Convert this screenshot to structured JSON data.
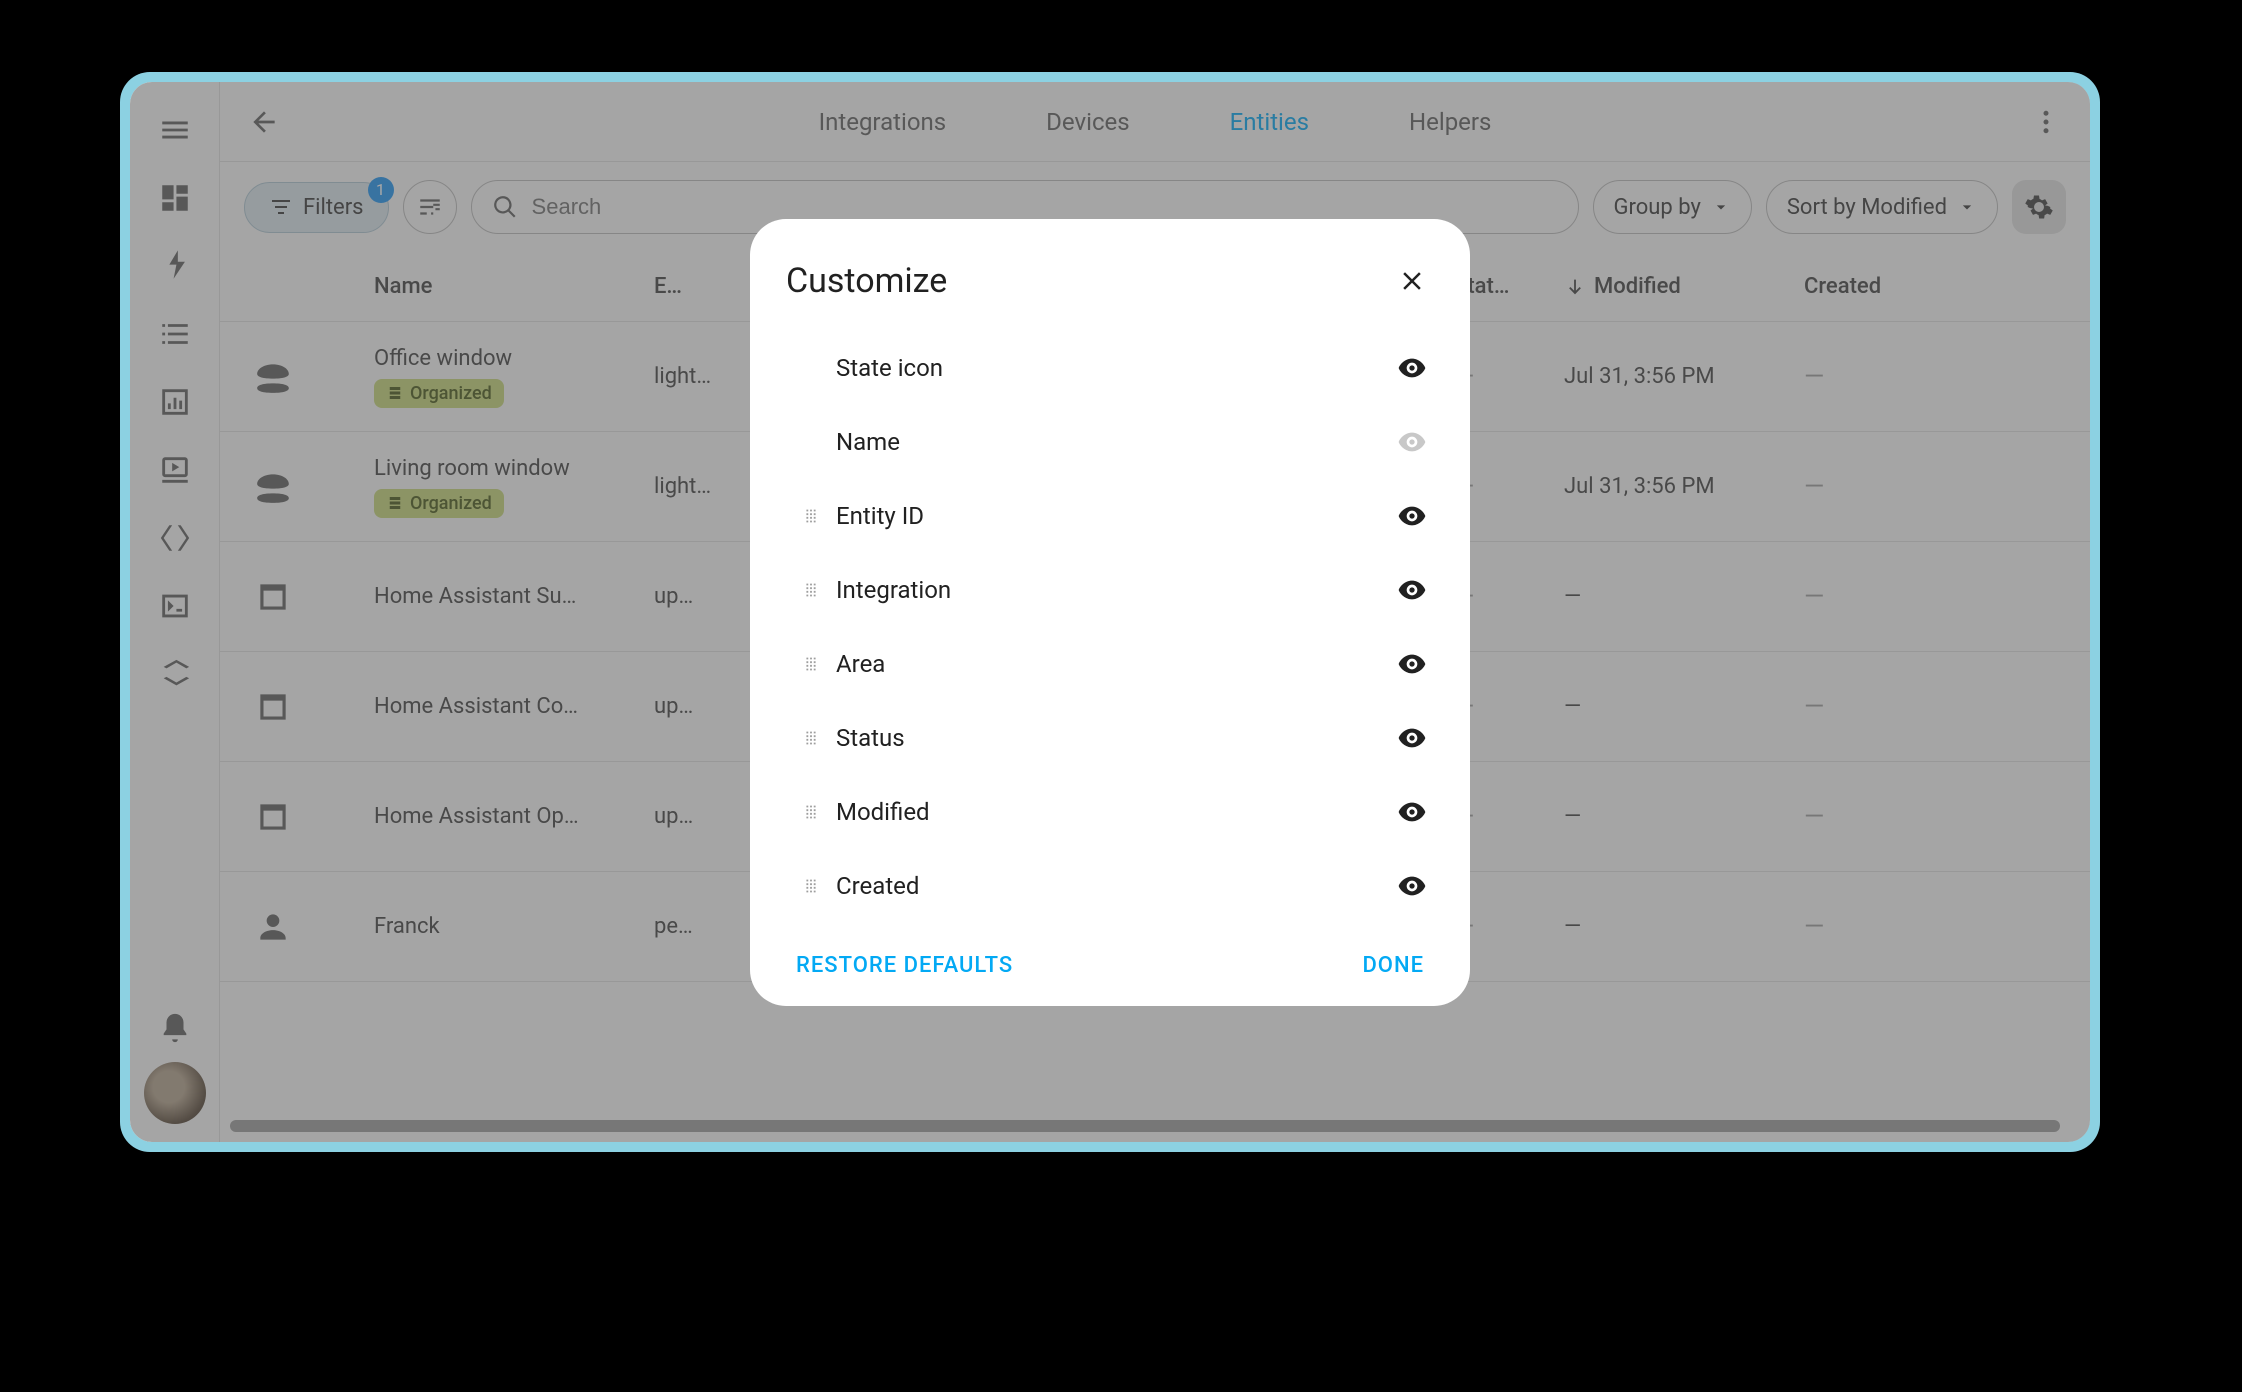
{
  "toolbar": {
    "filters_label": "Filters",
    "filters_badge": "1",
    "search_placeholder": "Search",
    "group_by_label": "Group by",
    "sort_label": "Sort by Modified"
  },
  "tabs": {
    "integrations": "Integrations",
    "devices": "Devices",
    "entities": "Entities",
    "helpers": "Helpers",
    "active": "Entities"
  },
  "columns": {
    "name": "Name",
    "entity_id": "Entity ID",
    "status": "Stat…",
    "modified": "Modified",
    "created": "Created"
  },
  "rows": [
    {
      "icon": "smoke",
      "name": "Office window",
      "organized": true,
      "organized_label": "Organized",
      "entity_col": "light…",
      "status": "—",
      "modified": "Jul 31, 3:56 PM",
      "created": "—"
    },
    {
      "icon": "smoke",
      "name": "Living room window",
      "organized": true,
      "organized_label": "Organized",
      "entity_col": "light…",
      "status": "—",
      "modified": "Jul 31, 3:56 PM",
      "created": "—"
    },
    {
      "icon": "package",
      "name": "Home Assistant Su…",
      "organized": false,
      "entity_col": "up…",
      "status": "—",
      "modified": "—",
      "created": "—"
    },
    {
      "icon": "package",
      "name": "Home Assistant Co…",
      "organized": false,
      "entity_col": "up…",
      "status": "—",
      "modified": "—",
      "created": "—"
    },
    {
      "icon": "package",
      "name": "Home Assistant Op…",
      "organized": false,
      "entity_col": "up…",
      "status": "—",
      "modified": "—",
      "created": "—"
    },
    {
      "icon": "person",
      "name": "Franck",
      "organized": false,
      "entity_col": "pe…",
      "status": "—",
      "modified": "—",
      "created": "—"
    }
  ],
  "dialog": {
    "title": "Customize",
    "restore": "RESTORE DEFAULTS",
    "done": "DONE",
    "items": [
      {
        "label": "State icon",
        "draggable": false,
        "visible": true
      },
      {
        "label": "Name",
        "draggable": false,
        "visible": false
      },
      {
        "label": "Entity ID",
        "draggable": true,
        "visible": true
      },
      {
        "label": "Integration",
        "draggable": true,
        "visible": true
      },
      {
        "label": "Area",
        "draggable": true,
        "visible": true
      },
      {
        "label": "Status",
        "draggable": true,
        "visible": true
      },
      {
        "label": "Modified",
        "draggable": true,
        "visible": true
      },
      {
        "label": "Created",
        "draggable": true,
        "visible": true
      }
    ]
  }
}
